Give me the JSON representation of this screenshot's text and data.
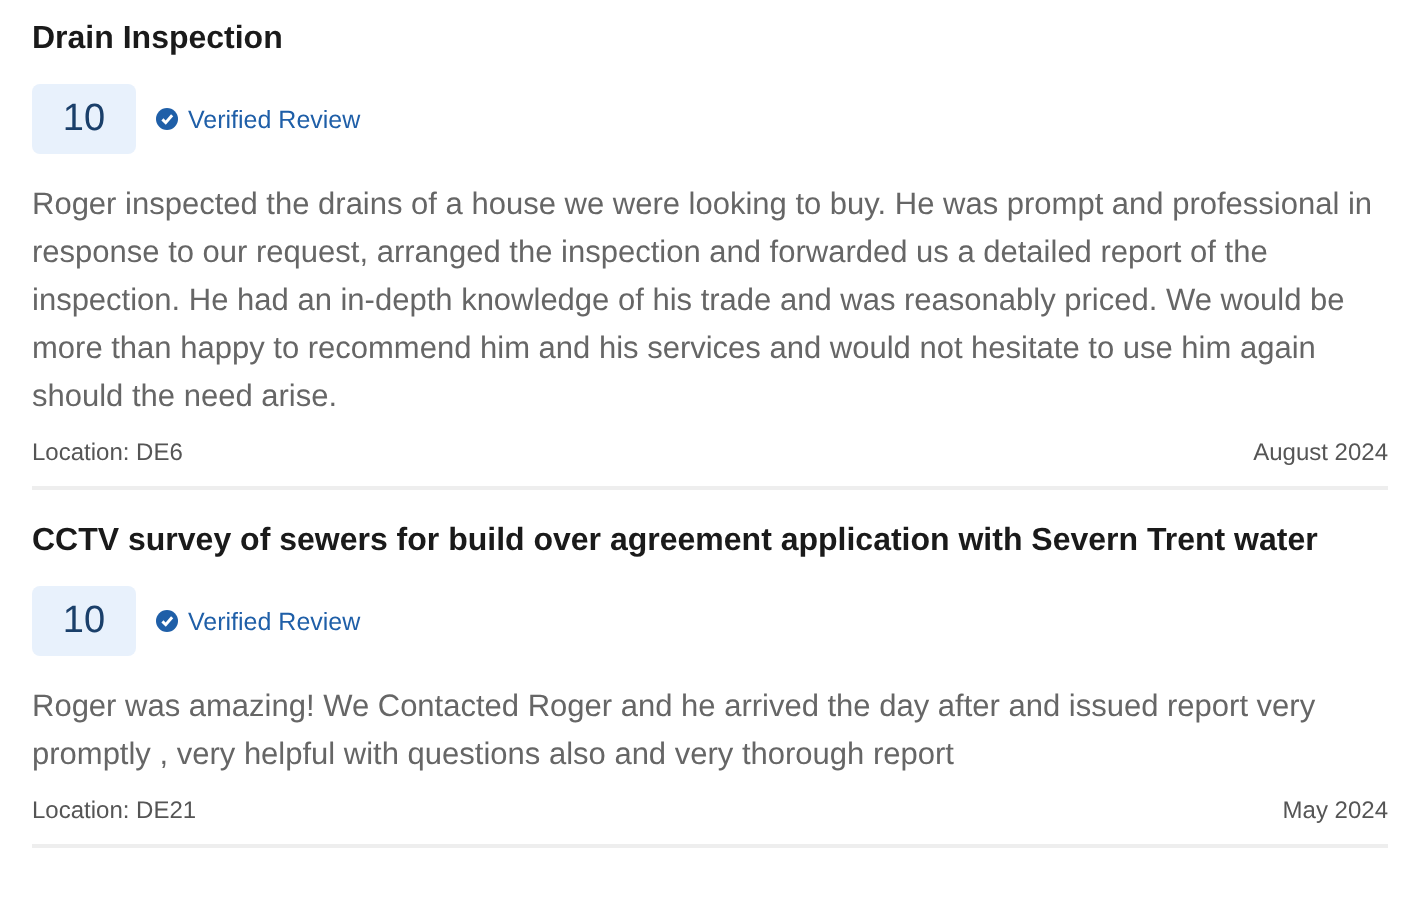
{
  "reviews": [
    {
      "title": "Drain Inspection",
      "score": "10",
      "badge": "Verified Review",
      "text": "Roger inspected the drains of a house we were looking to buy. He was prompt and professional in response to our request, arranged the inspection and forwarded us a detailed report of the inspection. He had an in-depth knowledge of his trade and was reasonably priced. We would be more than happy to recommend him and his services and would not hesitate to use him again should the need arise.",
      "location": "Location: DE6",
      "date": "August 2024"
    },
    {
      "title": "CCTV survey of sewers for build over agreement application with Severn Trent water",
      "score": "10",
      "badge": "Verified Review",
      "text": "Roger was amazing! We Contacted Roger and he arrived the day after and issued report very promptly , very helpful with questions also and very thorough report",
      "location": "Location: DE21",
      "date": "May 2024"
    }
  ]
}
